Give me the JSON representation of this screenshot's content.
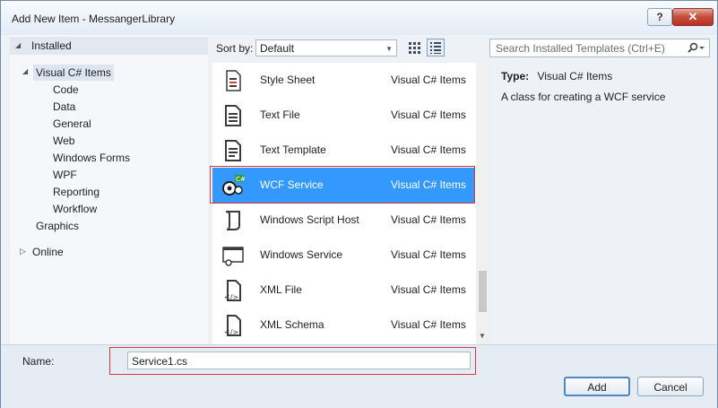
{
  "window": {
    "title": "Add New Item - MessangerLibrary",
    "help_glyph": "?",
    "close_glyph": "✕"
  },
  "left_tree": {
    "installed": "Installed",
    "root": "Visual C# Items",
    "children": [
      "Code",
      "Data",
      "General",
      "Web",
      "Windows Forms",
      "WPF",
      "Reporting",
      "Workflow"
    ],
    "graphics": "Graphics",
    "online": "Online"
  },
  "toolbar": {
    "sort_label": "Sort by:",
    "sort_value": "Default"
  },
  "search": {
    "placeholder": "Search Installed Templates (Ctrl+E)"
  },
  "templates": [
    {
      "name": "Style Sheet",
      "category": "Visual C# Items",
      "icon": "stylesheet-icon"
    },
    {
      "name": "Text File",
      "category": "Visual C# Items",
      "icon": "textfile-icon"
    },
    {
      "name": "Text Template",
      "category": "Visual C# Items",
      "icon": "texttemplate-icon"
    },
    {
      "name": "WCF Service",
      "category": "Visual C# Items",
      "icon": "wcf-service-icon",
      "selected": true
    },
    {
      "name": "Windows Script Host",
      "category": "Visual C# Items",
      "icon": "script-host-icon"
    },
    {
      "name": "Windows Service",
      "category": "Visual C# Items",
      "icon": "windows-service-icon"
    },
    {
      "name": "XML File",
      "category": "Visual C# Items",
      "icon": "xml-file-icon"
    },
    {
      "name": "XML Schema",
      "category": "Visual C# Items",
      "icon": "xml-schema-icon"
    }
  ],
  "details": {
    "type_label": "Type:",
    "type_value": "Visual C# Items",
    "description": "A class for creating a WCF service"
  },
  "bottom": {
    "name_label": "Name:",
    "name_value": "Service1.cs",
    "add_label": "Add",
    "cancel_label": "Cancel"
  },
  "colors": {
    "selection": "#3399ff",
    "highlight_border": "#d23c3c"
  }
}
